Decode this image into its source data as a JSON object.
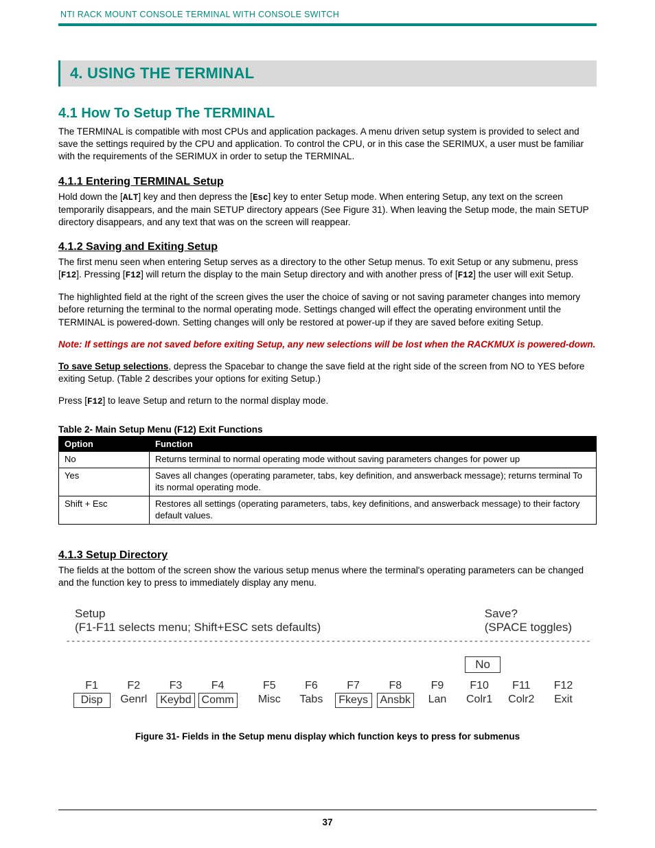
{
  "header": {
    "running": "NTI RACK MOUNT CONSOLE TERMINAL WITH CONSOLE SWITCH"
  },
  "section": {
    "title": "4. USING THE TERMINAL"
  },
  "s41": {
    "title": "4.1 How To Setup The TERMINAL",
    "intro": "The TERMINAL is compatible with most CPUs and application packages. A menu driven setup system is provided to select and save the settings required by the CPU and application.   To control the CPU,  or in this case the SERIMUX, a user must be familiar with the requirements of the SERIMUX in order to setup the TERMINAL."
  },
  "s411": {
    "title": "4.1.1 Entering TERMINAL Setup",
    "p1a": "Hold down the [",
    "k1": "ALT",
    "p1b": "] key and then depress the [",
    "k2": "Esc",
    "p1c": "] key to enter Setup mode.  When entering Setup, any text on the screen temporarily disappears, and the main SETUP directory appears (See Figure 31). When leaving the Setup mode, the main SETUP directory disappears, and any text that was on the screen will reappear."
  },
  "s412": {
    "title": "4.1.2 Saving and Exiting Setup",
    "p1a": "The first menu seen when entering Setup serves as a directory to the other Setup menus. To exit Setup or any submenu, press [",
    "k1": "F12",
    "p1b": "].    Pressing [",
    "k2": "F12",
    "p1c": "] will return the display to the main Setup directory and with another press of [",
    "k3": "F12",
    "p1d": "] the user will exit  Setup.",
    "p2": "The highlighted field at the right of the screen gives the user the choice of saving or not saving parameter changes into memory before returning the terminal to the normal operating mode.    Settings changed will effect the operating environment until the TERMINAL is powered-down. Setting changes will only be restored at power-up if  they are saved before exiting Setup.",
    "note": "Note:  If settings are not saved before exiting Setup, any new selections will be lost when the RACKMUX is powered-down.",
    "save_u": "To save Setup selections",
    "save_rest": ", depress the Spacebar to change the save field at the right side of the screen from NO to YES before exiting Setup. (Table 2 describes your options for exiting Setup.)",
    "p3a": "Press [",
    "k4": "F12",
    "p3b": "] to leave Setup and return to the normal display mode."
  },
  "table2": {
    "caption": "Table 2- Main Setup Menu (F12) Exit Functions",
    "h1": "Option",
    "h2": "Function",
    "rows": [
      {
        "opt": "No",
        "fn": "Returns terminal to normal operating mode without saving parameters changes for power up"
      },
      {
        "opt": "Yes",
        "fn": "Saves all changes (operating parameter, tabs, key definition, and answerback message); returns terminal To its normal operating mode."
      },
      {
        "opt": "Shift + Esc",
        "fn": "Restores all settings (operating parameters, tabs, key definitions, and answerback message) to their factory default values."
      }
    ]
  },
  "s413": {
    "title": "4.1.3 Setup Directory",
    "p1": "The fields at the bottom of the screen show the various setup menus where the terminal's operating parameters can be changed and the function key to press to immediately display any menu."
  },
  "figure": {
    "setup": "Setup",
    "hint": "(F1-F11 selects menu; Shift+ESC sets defaults)",
    "save": "Save?",
    "space": "(SPACE toggles)",
    "no": "No",
    "keys": [
      {
        "f": "F1",
        "l": "Disp",
        "border": true
      },
      {
        "f": "F2",
        "l": "Genrl",
        "border": false
      },
      {
        "f": "F3",
        "l": "Keybd",
        "border": true
      },
      {
        "f": "F4",
        "l": "Comm",
        "border": true
      },
      {
        "f": "F5",
        "l": "Misc",
        "border": false
      },
      {
        "f": "F6",
        "l": "Tabs",
        "border": false
      },
      {
        "f": "F7",
        "l": "Fkeys",
        "border": true
      },
      {
        "f": "F8",
        "l": "Ansbk",
        "border": true
      },
      {
        "f": "F9",
        "l": "Lan",
        "border": false
      },
      {
        "f": "F10",
        "l": "Colr1",
        "border": false
      },
      {
        "f": "F11",
        "l": "Colr2",
        "border": false
      },
      {
        "f": "F12",
        "l": "Exit",
        "border": false
      }
    ],
    "caption": "Figure 31- Fields in the Setup menu display which function keys to press for submenus"
  },
  "pagenum": "37"
}
